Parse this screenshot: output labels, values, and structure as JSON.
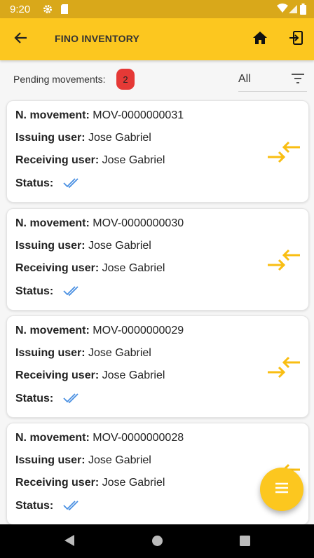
{
  "status_bar": {
    "time": "9:20"
  },
  "app_bar": {
    "title": "FINO INVENTORY"
  },
  "filter_bar": {
    "pending_label": "Pending movements:",
    "pending_count": "2",
    "filter_value": "All"
  },
  "labels": {
    "movement": "N. movement:",
    "issuing": "Issuing user:",
    "receiving": "Receiving user:",
    "status": "Status:"
  },
  "movements": [
    {
      "number": "MOV-0000000031",
      "issuing_user": "Jose Gabriel",
      "receiving_user": "Jose Gabriel",
      "status_icon": "double-check-icon"
    },
    {
      "number": "MOV-0000000030",
      "issuing_user": "Jose Gabriel",
      "receiving_user": "Jose Gabriel",
      "status_icon": "double-check-icon"
    },
    {
      "number": "MOV-0000000029",
      "issuing_user": "Jose Gabriel",
      "receiving_user": "Jose Gabriel",
      "status_icon": "double-check-icon"
    },
    {
      "number": "MOV-0000000028",
      "issuing_user": "Jose Gabriel",
      "receiving_user": "Jose Gabriel",
      "status_icon": "double-check-icon"
    }
  ],
  "colors": {
    "accent": "#fcc71f",
    "status_bar": "#d9a81a",
    "badge": "#e53936",
    "check": "#4a90e2"
  }
}
